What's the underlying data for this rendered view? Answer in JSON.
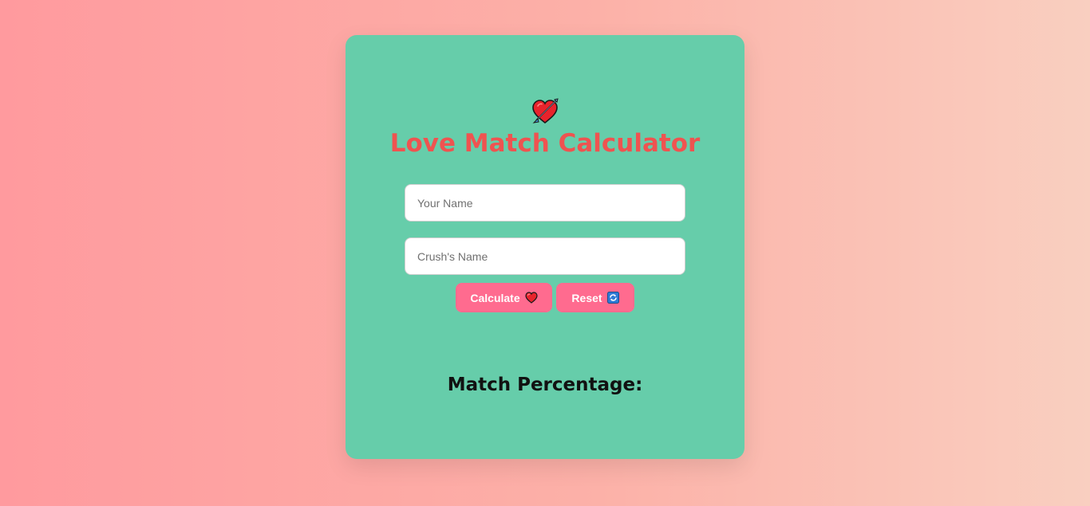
{
  "app": {
    "icon": "heart-with-arrow-icon",
    "title": "Love Match Calculator"
  },
  "form": {
    "your_name": {
      "placeholder": "Your Name",
      "value": ""
    },
    "crush_name": {
      "placeholder": "Crush's Name",
      "value": ""
    }
  },
  "buttons": {
    "calculate_label": "Calculate",
    "calculate_icon": "red-heart-icon",
    "reset_label": "Reset",
    "reset_icon": "refresh-icon"
  },
  "result": {
    "label": "Match Percentage:"
  },
  "colors": {
    "card": "#66cdaa",
    "title": "#ef5350",
    "button": "#ff6b8f"
  }
}
